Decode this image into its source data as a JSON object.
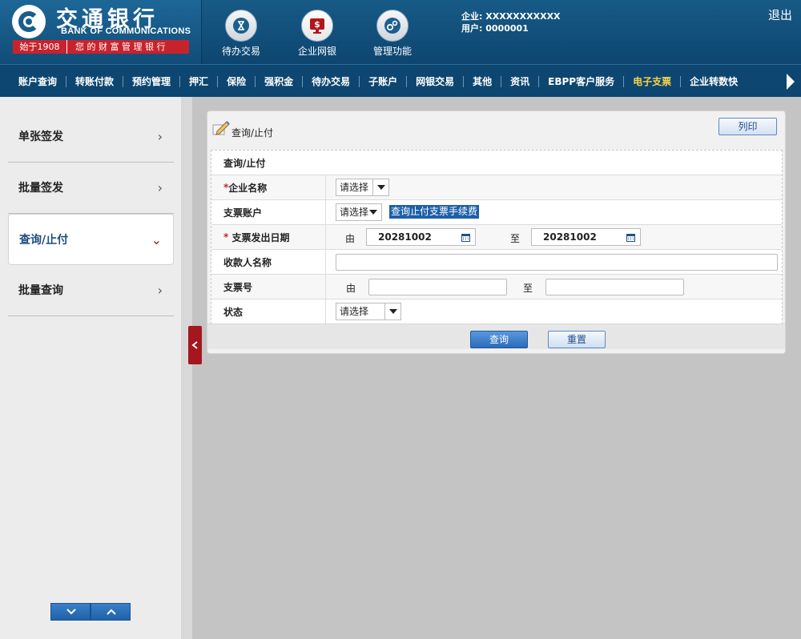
{
  "header": {
    "bank_name_cn": "交通银行",
    "bank_name_en": "BANK OF COMMUNICATIONS",
    "since": "始于1908",
    "slogan": "您的财富管理银行",
    "nav": [
      {
        "label": "待办交易",
        "icon": "pending-transactions-icon"
      },
      {
        "label": "企业网银",
        "icon": "corporate-banking-icon"
      },
      {
        "label": "管理功能",
        "icon": "management-gears-icon"
      }
    ],
    "company_label": "企业:",
    "company_value": "XXXXXXXXXXX",
    "user_label": "用户:",
    "user_value": "0000001",
    "logout": "退出"
  },
  "menu": [
    "账户查询",
    "转账付款",
    "预约管理",
    "押汇",
    "保险",
    "强积金",
    "待办交易",
    "子账户",
    "网银交易",
    "其他",
    "资讯",
    "EBPP客户服务",
    "电子支票",
    "企业转数快"
  ],
  "menu_highlight_index": 12,
  "sidebar": {
    "items": [
      "单张签发",
      "批量签发",
      "查询/止付",
      "批量查询"
    ],
    "active_index": 2
  },
  "panel": {
    "title": "查询/止付",
    "print_label": "列印",
    "form_title": "查询/止付",
    "company_name_label": "企业名称",
    "company_name_select": "请选择",
    "cheque_account_label": "支票账户",
    "cheque_account_select": "请选择",
    "fee_link": "查询止付支票手续费",
    "issue_date_label": "支票发出日期",
    "from_label": "由",
    "to_label": "至",
    "date_from": "20281002",
    "date_to": "20281002",
    "payee_label": "收款人名称",
    "payee_value": "",
    "cheque_no_label": "支票号",
    "cheque_from": "",
    "cheque_to": "",
    "status_label": "状态",
    "status_select": "请选择",
    "query_button": "查询",
    "reset_button": "重置"
  },
  "colors": {
    "header_bg": "#0d4670",
    "brand_red": "#c8232c",
    "menu_highlight": "#f7d34d",
    "primary_button": "#2a6cb9"
  }
}
